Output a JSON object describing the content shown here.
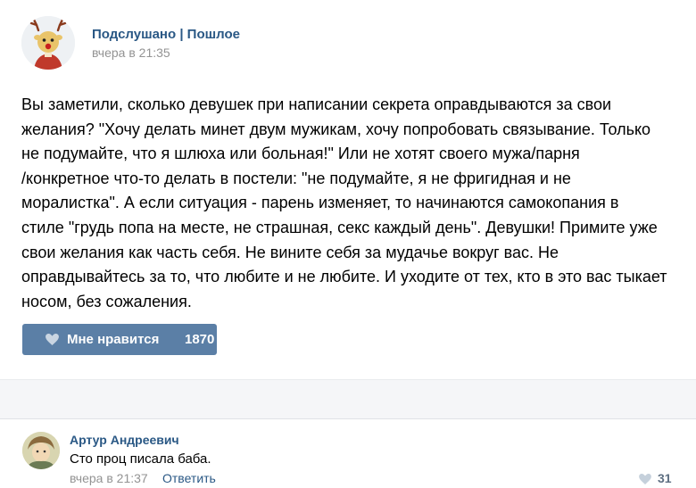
{
  "post": {
    "author": "Подслушано | Пошлое",
    "date": "вчера в 21:35",
    "text_lines": [
      "Вы заметили, сколько девушек при написании секрета оправдываются за свои",
      "желания? \"Хочу делать минет двум мужикам, хочу попробовать связывание. Только",
      "не подумайте, что я шлюха или больная!\" Или не хотят своего мужа/парня",
      "/конкретное что-то делать в постели: \"не подумайте, я не фригидная и не",
      "моралистка\". А если ситуация - парень изменяет, то начинаются самокопания в",
      "стиле \"грудь попа на месте, не страшная, секс каждый день\". Девушки! Примите уже",
      "свои желания как часть себя. Не вините себя за мудачье вокруг вас. Не",
      "оправдывайтесь за то, что любите и не любите. И уходите от тех, кто в это вас тыкает",
      "носом, без сожаления."
    ],
    "like_label": "Мне нравится",
    "like_count": "1870",
    "avatar_icon": "reindeer-avatar-icon"
  },
  "comment": {
    "author": "Артур Андреевич",
    "text": "Сто проц писала баба.",
    "date": "вчера в 21:37",
    "reply_label": "Ответить",
    "like_count": "31",
    "avatar_icon": "user-avatar-icon"
  },
  "colors": {
    "link": "#2a5885",
    "meta": "#939393",
    "like_button_bg": "#5b7fa6",
    "separator_bg": "#f5f6f8"
  }
}
